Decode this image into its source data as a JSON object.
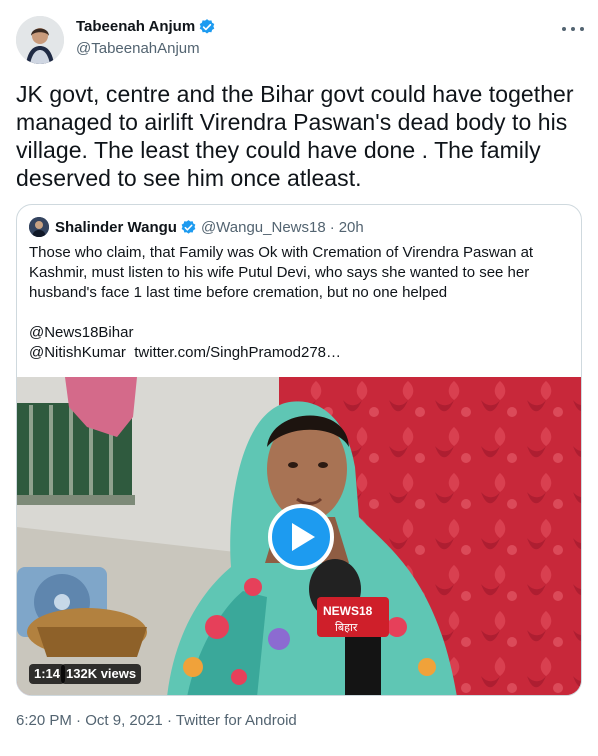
{
  "author": {
    "display_name": "Tabeenah Anjum",
    "handle": "@TabeenahAnjum",
    "verified_icon": "verified-badge-icon"
  },
  "tweet": {
    "text": "JK govt, centre and the Bihar govt could have together managed to airlift Virendra Paswan's dead body to his village. The least they could have done . The family deserved to see him once atleast."
  },
  "quote": {
    "display_name": "Shalinder Wangu",
    "handle": "@Wangu_News18",
    "separator": "·",
    "time": "20h",
    "text": "Those who claim, that Family was Ok with Cremation of Virendra Paswan at Kashmir, must listen to his wife Putul Devi, who says she wanted to see her husband's face 1 last time before cremation, but no one helped",
    "mention_1": "@News18Bihar",
    "mention_2": "@NitishKumar",
    "link": "twitter.com/SinghPramod278…",
    "video": {
      "duration": "1:14",
      "views": "132K views",
      "mic_brand": "NEWS18",
      "mic_sub": "बिहार"
    }
  },
  "meta": {
    "time": "6:20 PM",
    "sep1": "·",
    "date": "Oct 9, 2021",
    "sep2": "·",
    "source": "Twitter for Android"
  },
  "colors": {
    "verified": "#1d9bf0",
    "secondary_text": "#536471",
    "border": "#cfd9de",
    "play_button": "#1d9bf0"
  }
}
